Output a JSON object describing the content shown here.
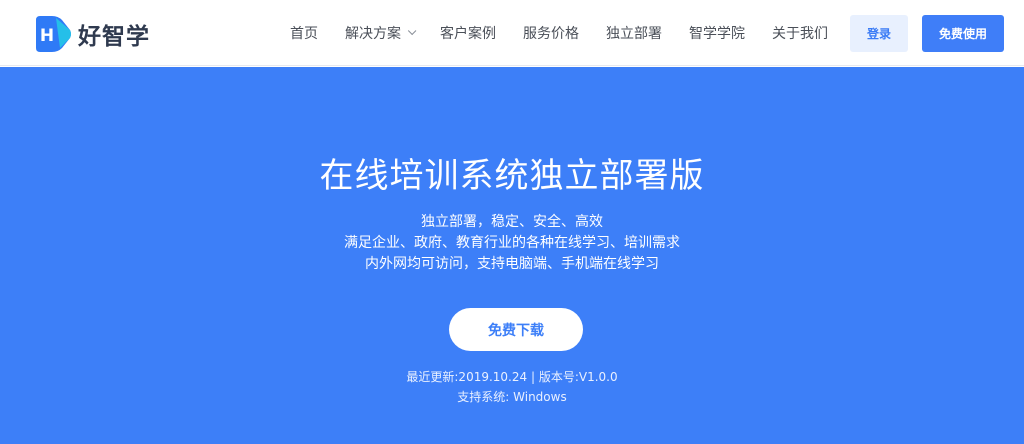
{
  "brand": {
    "logo_letter": "H",
    "name": "好智学"
  },
  "nav": {
    "items": [
      {
        "label": "首页"
      },
      {
        "label": "解决方案",
        "has_dropdown": true
      },
      {
        "label": "客户案例"
      },
      {
        "label": "服务价格"
      },
      {
        "label": "独立部署"
      },
      {
        "label": "智学学院"
      },
      {
        "label": "关于我们"
      }
    ],
    "login_label": "登录",
    "free_use_label": "免费使用"
  },
  "hero": {
    "title": "在线培训系统独立部署版",
    "lines": [
      "独立部署，稳定、安全、高效",
      "满足企业、政府、教育行业的各种在线学习、培训需求",
      "内外网均可访问，支持电脑端、手机端在线学习"
    ],
    "download_label": "免费下载",
    "update_line": "最近更新:2019.10.24 | 版本号:V1.0.0",
    "system_line": "支持系统:  Windows"
  },
  "colors": {
    "accent": "#3d7ff8",
    "logo_blue": "#2f7af6",
    "logo_cyan": "#25c7e8",
    "login_bg": "#e8f0fe"
  },
  "icons": {
    "logo": "brand-logo-icon",
    "dropdown": "chevron-down-icon"
  }
}
